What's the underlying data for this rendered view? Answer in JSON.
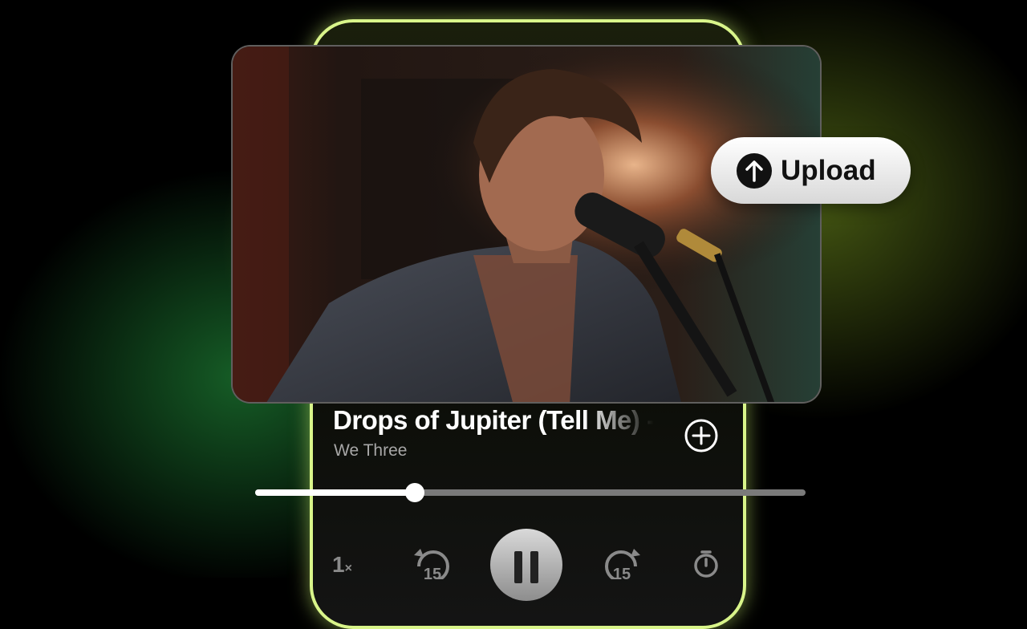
{
  "track": {
    "title": "Drops of Jupiter (Tell Me) -",
    "artist": "We Three",
    "progress": 0.29
  },
  "upload_button": {
    "label": "Upload",
    "icon": "arrow-up-icon"
  },
  "add_button": {
    "icon": "plus-circle-icon"
  },
  "controls": {
    "speed_value": "1",
    "speed_unit": "×",
    "rewind_seconds": "15",
    "forward_seconds": "15",
    "play_state": "pause-icon",
    "timer_icon": "timer-icon"
  },
  "colors": {
    "phone_border": "#d9f58a",
    "glow_green": "#28aa46",
    "glow_lime": "#bee63c",
    "progress_played": "#ffffff",
    "progress_remaining": "#7a7a7a"
  }
}
